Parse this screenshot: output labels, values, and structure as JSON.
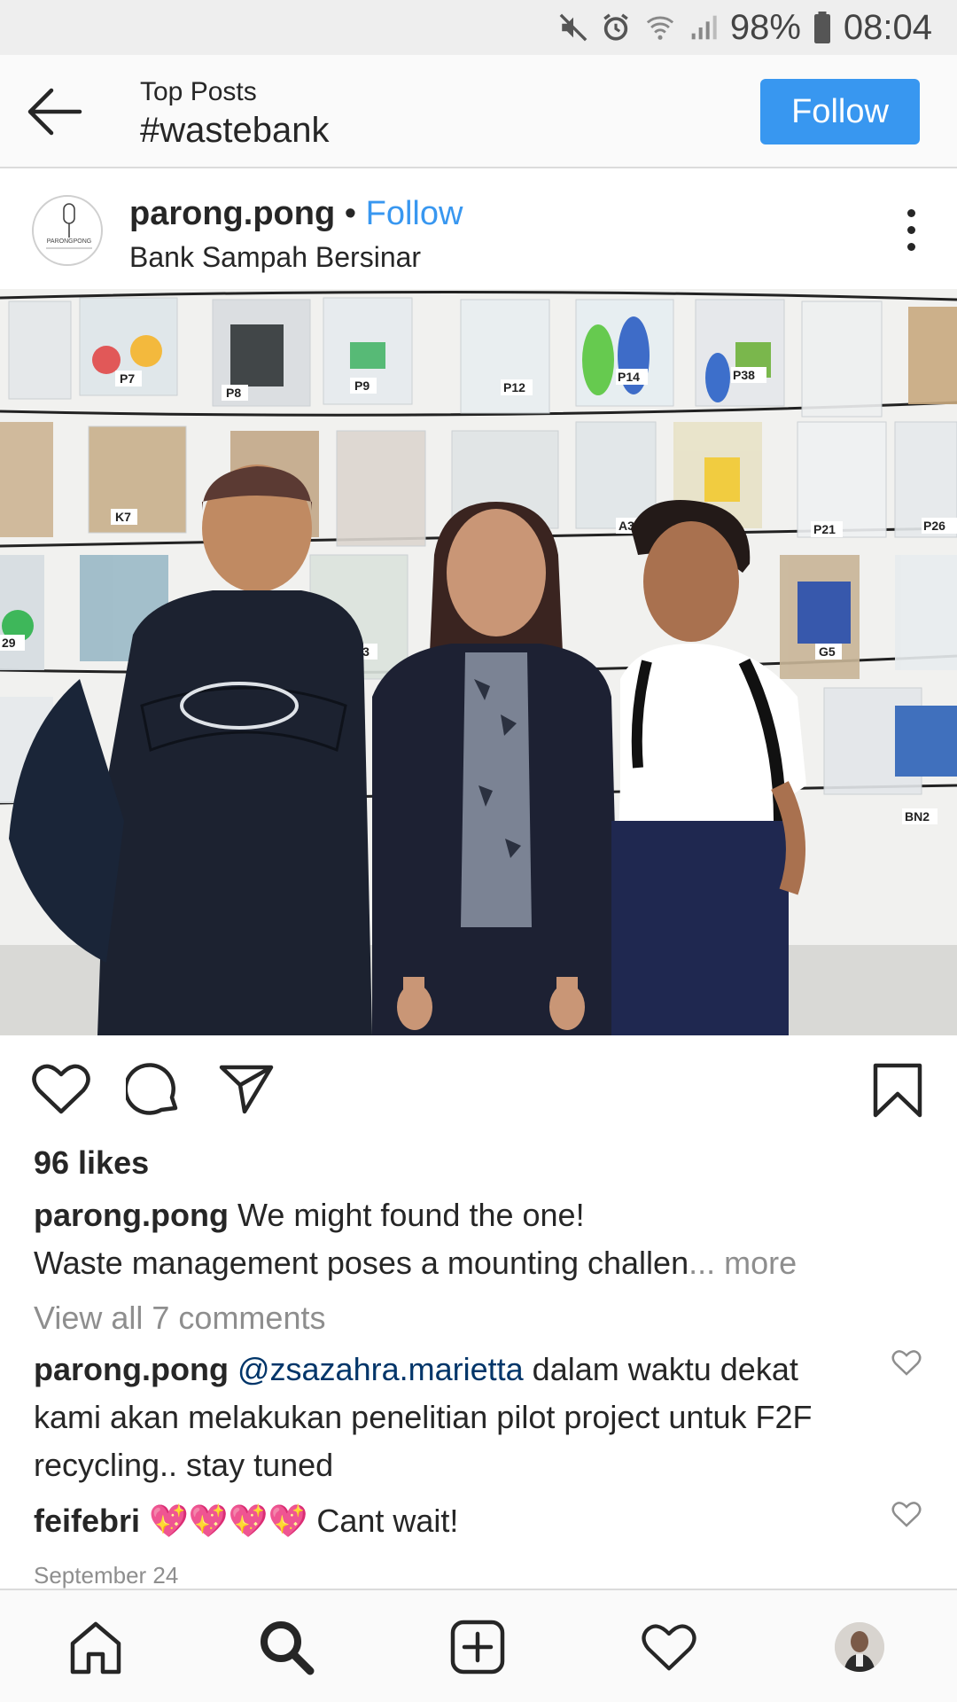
{
  "status_bar": {
    "battery_pct": "98%",
    "time": "08:04",
    "icons": [
      "mute-icon",
      "alarm-icon",
      "wifi-icon",
      "signal-icon",
      "battery-icon"
    ]
  },
  "header": {
    "subtitle": "Top Posts",
    "title": "#wastebank",
    "follow_label": "Follow",
    "accent": "#3897f0"
  },
  "post": {
    "username": "parong.pong",
    "separator": "•",
    "follow_label": "Follow",
    "location": "Bank Sampah Bersinar",
    "avatar_text": "PARONGPONG",
    "likes": "96 likes",
    "caption_user": "parong.pong",
    "caption_line1": "We might found the one!",
    "caption_line2": "Waste management poses a mounting challen",
    "caption_more": "... more",
    "view_comments": "View all 7 comments",
    "comments": [
      {
        "user": "parong.pong",
        "mention": "@zsazahra.marietta",
        "text": "dalam waktu dekat kami akan melakukan penelitian pilot project untuk F2F recycling.. stay tuned"
      },
      {
        "user": "feifebri",
        "emoji": "💖💖💖💖",
        "text": "Cant wait!"
      }
    ],
    "date": "September 24",
    "photo_labels": [
      "P7",
      "P8",
      "P9",
      "P12",
      "P14",
      "P38",
      "K7",
      "A3",
      "P21",
      "P26",
      "29",
      "P33",
      "G5",
      "BN2"
    ]
  },
  "nav": {
    "items": [
      "home-icon",
      "search-icon",
      "add-icon",
      "heart-icon",
      "profile-avatar"
    ]
  }
}
